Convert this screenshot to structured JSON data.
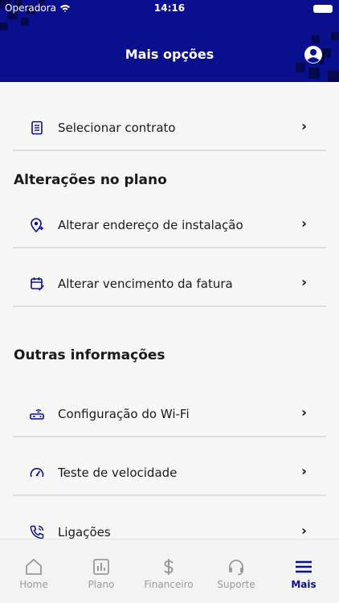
{
  "status_bar": {
    "carrier": "Operadora",
    "time": "14:16"
  },
  "header": {
    "title": "Mais opções"
  },
  "menu": {
    "select_contract": "Selecionar contrato",
    "plan_changes_title": "Alterações no plano",
    "change_address": "Alterar endereço de instalação",
    "change_due_date": "Alterar vencimento da fatura",
    "other_info_title": "Outras informações",
    "wifi_config": "Configuração do Wi-Fi",
    "speed_test": "Teste de velocidade",
    "calls": "Ligações",
    "chevron": "›"
  },
  "tabs": [
    {
      "label": "Home",
      "icon": "home-icon",
      "active": false
    },
    {
      "label": "Plano",
      "icon": "plan-chart-icon",
      "active": false
    },
    {
      "label": "Financeiro",
      "icon": "dollar-icon",
      "active": false
    },
    {
      "label": "Suporte",
      "icon": "headset-icon",
      "active": false
    },
    {
      "label": "Mais",
      "icon": "menu-icon",
      "active": true
    }
  ],
  "colors": {
    "brand": "#0a0f8e",
    "background": "#f7f7f7",
    "inactive_tab": "#9a9a9a"
  }
}
